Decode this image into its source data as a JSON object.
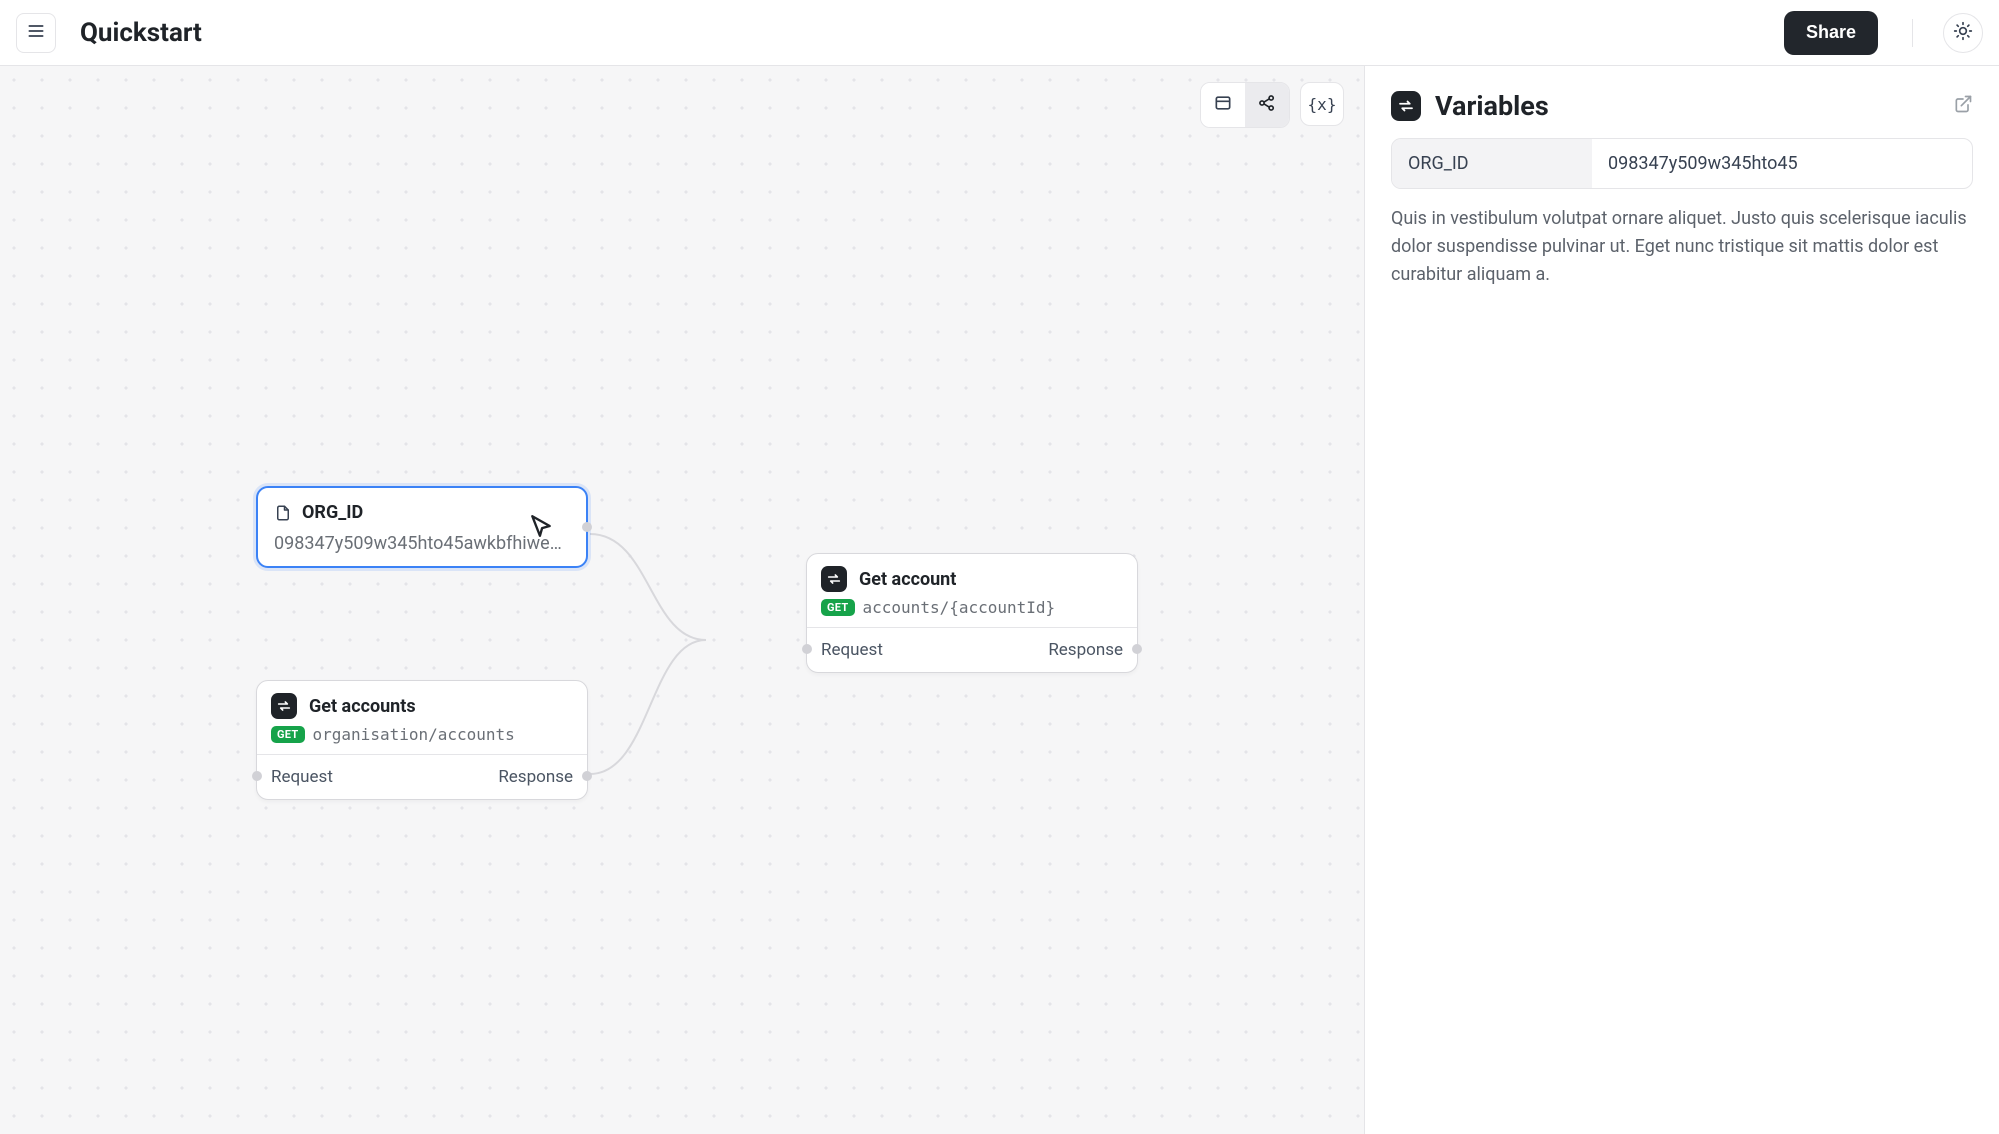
{
  "header": {
    "title": "Quickstart",
    "share_label": "Share"
  },
  "canvas": {
    "nodes": {
      "var": {
        "name": "ORG_ID",
        "value": "098347y509w345hto45awkbfhiweh…"
      },
      "get_account": {
        "title": "Get account",
        "method": "GET",
        "path": "accounts/{accountId}",
        "request_label": "Request",
        "response_label": "Response"
      },
      "get_accounts": {
        "title": "Get accounts",
        "method": "GET",
        "path": "organisation/accounts",
        "request_label": "Request",
        "response_label": "Response"
      }
    },
    "toolbar": {
      "vars_btn": "{x}"
    }
  },
  "side": {
    "title": "Variables",
    "var": {
      "key": "ORG_ID",
      "value": "098347y509w345hto45"
    },
    "description": "Quis in vestibulum volutpat ornare aliquet. Justo quis scelerisque iaculis dolor suspendisse pulvinar ut. Eget nunc tristique sit mattis dolor est curabitur aliquam a."
  }
}
